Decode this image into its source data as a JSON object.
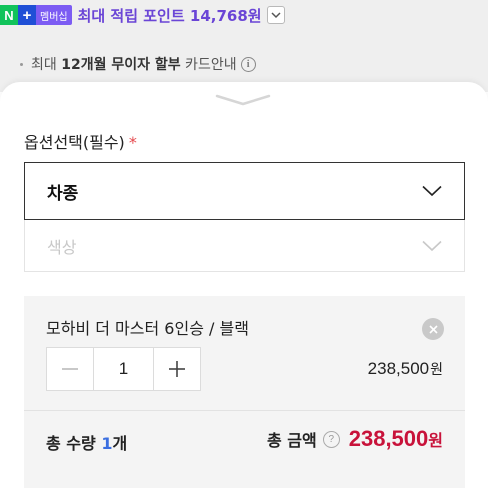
{
  "npay": {
    "n_label": "N",
    "plus_label": "+",
    "member_label": "멤버십",
    "points_text": "최대 적립 포인트 14,768원"
  },
  "installment": {
    "prefix": "최대 ",
    "emphasis": "12개월 무이자 할부",
    "suffix": " 카드안내",
    "info_icon": "i"
  },
  "option": {
    "label": "옵션선택(필수)",
    "required_mark": "*",
    "select_car_label": "차종",
    "select_color_label": "색상"
  },
  "selected_item": {
    "name": "모하비 더 마스터 6인승 / 블랙",
    "quantity": "1",
    "minus_label": "−",
    "plus_label": "+",
    "price": "238,500",
    "price_unit": "원"
  },
  "total": {
    "qty_prefix": "총 수량 ",
    "qty_count": "1",
    "qty_suffix": "개",
    "price_label": "총 금액",
    "help_icon": "?",
    "price": "238,500",
    "price_unit": "원"
  },
  "colors": {
    "npay_green": "#11c35a",
    "npay_blue": "#1f4fd6",
    "member_purple": "#7c5cf3",
    "points_purple": "#6a45d6",
    "total_price_red": "#c8123a",
    "qty_count_blue": "#3b6fe0"
  }
}
